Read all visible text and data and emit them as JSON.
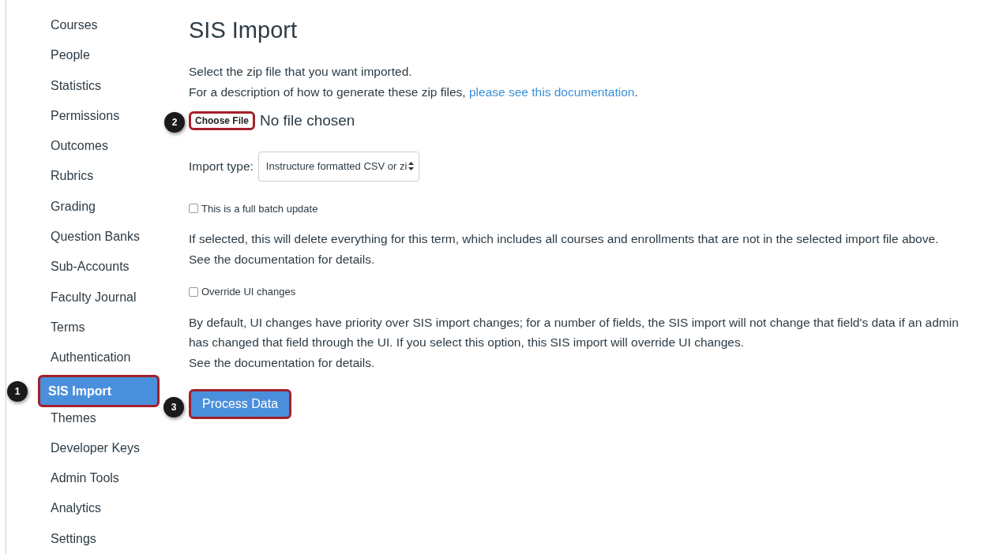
{
  "sidebar": {
    "items": [
      {
        "label": "Courses",
        "selected": false
      },
      {
        "label": "People",
        "selected": false
      },
      {
        "label": "Statistics",
        "selected": false
      },
      {
        "label": "Permissions",
        "selected": false
      },
      {
        "label": "Outcomes",
        "selected": false
      },
      {
        "label": "Rubrics",
        "selected": false
      },
      {
        "label": "Grading",
        "selected": false
      },
      {
        "label": "Question Banks",
        "selected": false
      },
      {
        "label": "Sub-Accounts",
        "selected": false
      },
      {
        "label": "Faculty Journal",
        "selected": false
      },
      {
        "label": "Terms",
        "selected": false
      },
      {
        "label": "Authentication",
        "selected": false
      },
      {
        "label": "SIS Import",
        "selected": true,
        "callout": "1"
      },
      {
        "label": "Themes",
        "selected": false
      },
      {
        "label": "Developer Keys",
        "selected": false
      },
      {
        "label": "Admin Tools",
        "selected": false
      },
      {
        "label": "Analytics",
        "selected": false
      },
      {
        "label": "Settings",
        "selected": false
      }
    ]
  },
  "page": {
    "title": "SIS Import",
    "intro": "Select the zip file that you want imported.",
    "doc_line": {
      "before": "For a description of how to generate these zip files, ",
      "link": "please see this documentation",
      "after": "."
    },
    "file_input": {
      "button": "Choose File",
      "status": "No file chosen",
      "callout": "2"
    },
    "import_type": {
      "label": "Import type:",
      "value": "Instructure formatted CSV or zi"
    },
    "options": [
      {
        "label": "This is a full batch update",
        "checked": false,
        "help": [
          "If selected, this will delete everything for this term, which includes all courses and enrollments that are not in the selected import file above.",
          "See the documentation for details."
        ]
      },
      {
        "label": "Override UI changes",
        "checked": false,
        "help": [
          "By default, UI changes have priority over SIS import changes; for a number of fields, the SIS import will not change that field's data if an admin has changed that field through the UI. If you select this option, this SIS import will override UI changes.",
          "See the documentation for details."
        ]
      }
    ],
    "submit": {
      "label": "Process Data",
      "callout": "3"
    }
  }
}
